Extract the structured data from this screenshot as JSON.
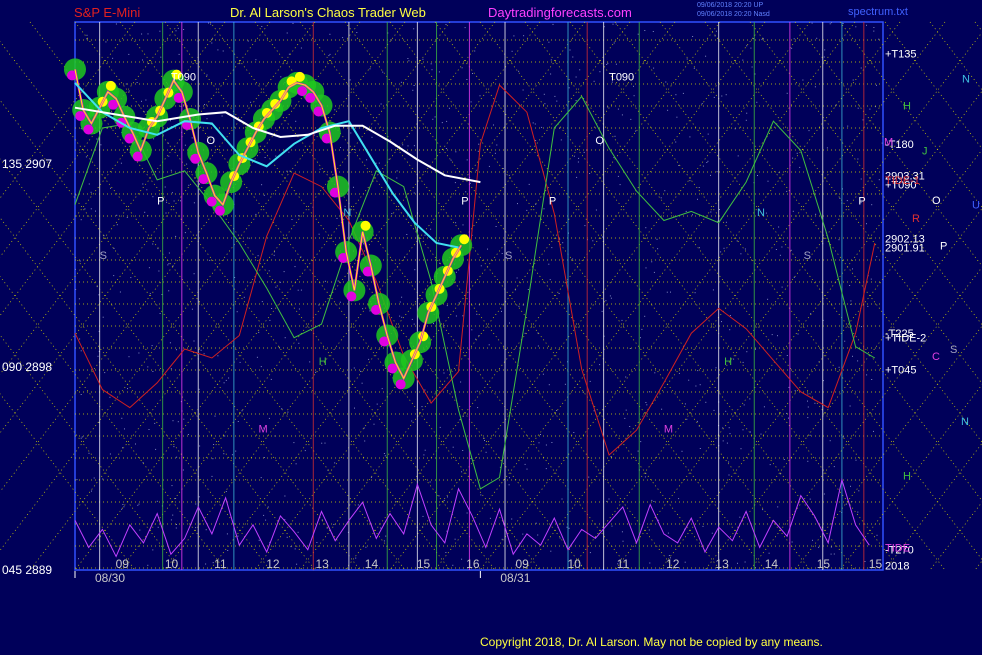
{
  "header": {
    "left": "S&P E-Mini",
    "center": "Dr. Al Larson's Chaos Trader Web",
    "site": "Daytradingforecasts.com",
    "stamp1": "09/06/2018 20:20 UP",
    "stamp2": "09/06/2018 20:20 Nasd",
    "right": "spectrum.txt"
  },
  "footer": {
    "copyright": "Copyright 2018, Dr. Al Larson. May not be copied by any means."
  },
  "colors": {
    "background": "#00005a",
    "grid_yellow": "#d8d800",
    "price_magenta": "#e000e0",
    "highlight_green": "#1ec81e",
    "highlight_yellow": "#ffff00",
    "ma_cyan": "#40e0f0",
    "ma_white": "#ffffff",
    "cycle_red": "#d02020",
    "cycle_green": "#40c040",
    "spectrum_violet": "#c040ff"
  },
  "chart_data": {
    "type": "line",
    "x_day_labels": [
      {
        "text": "08/30",
        "x": 0
      },
      {
        "text": "08/31",
        "x": 14.8
      }
    ],
    "x_hour_ticks": [
      {
        "text": "09",
        "x": 1.7
      },
      {
        "text": "10",
        "x": 3.5
      },
      {
        "text": "11",
        "x": 5.3
      },
      {
        "text": "12",
        "x": 7.2
      },
      {
        "text": "13",
        "x": 9.0
      },
      {
        "text": "14",
        "x": 10.8
      },
      {
        "text": "15",
        "x": 12.7
      },
      {
        "text": "16",
        "x": 14.5
      },
      {
        "text": "09",
        "x": 16.3
      },
      {
        "text": "10",
        "x": 18.2
      },
      {
        "text": "11",
        "x": 20.0
      },
      {
        "text": "12",
        "x": 21.8
      },
      {
        "text": "13",
        "x": 23.6
      },
      {
        "text": "14",
        "x": 25.4
      },
      {
        "text": "15",
        "x": 27.3
      },
      {
        "text": "15",
        "x": 29.2
      }
    ],
    "xlim": [
      0,
      29.5
    ],
    "y_left_ticks": [
      {
        "text": "135  2907",
        "y": 2907
      },
      {
        "text": "090  2898",
        "y": 2898
      },
      {
        "text": "045  2889",
        "y": 2889
      }
    ],
    "ylim": [
      2889,
      2913.3
    ],
    "right_labels": [
      {
        "text": "+T135",
        "y": 2911.9,
        "color": "#ffffff"
      },
      {
        "text": "-T180",
        "y": 2907.9,
        "color": "#ffffff"
      },
      {
        "text": "2903.31",
        "y": 2906.5,
        "color": "#ffffff"
      },
      {
        "text": "+T090",
        "y": 2906.1,
        "color": "#ffffff"
      },
      {
        "text": "2902.13",
        "y": 2903.7,
        "color": "#ffffff"
      },
      {
        "text": "2901.91",
        "y": 2903.3,
        "color": "#ffffff"
      },
      {
        "text": "-T225",
        "y": 2899.5,
        "color": "#ffffff"
      },
      {
        "text": "+TIDE-2",
        "y": 2899.3,
        "color": "#ffffff"
      },
      {
        "text": "+T045",
        "y": 2897.9,
        "color": "#ffffff"
      },
      {
        "text": "-T270",
        "y": 2889.9,
        "color": "#ffffff"
      },
      {
        "text": "TIDE",
        "y": 2890.0,
        "color": "#e040e0"
      },
      {
        "text": "2018",
        "y": 2889.2,
        "color": "#ffffff"
      },
      {
        "text": "TIDE-1",
        "y": 2906.3,
        "color": "#e03030"
      }
    ],
    "side_letters": [
      {
        "text": "N",
        "color": "#40c0e0",
        "y": 2910.8
      },
      {
        "text": "H",
        "color": "#40c040",
        "y": 2909.6
      },
      {
        "text": "M",
        "color": "#e040e0",
        "y": 2908.0
      },
      {
        "text": "J",
        "color": "#40c040",
        "y": 2907.6
      },
      {
        "text": "O",
        "color": "#ffffff",
        "y": 2905.4
      },
      {
        "text": "U",
        "color": "#4060ff",
        "y": 2905.2
      },
      {
        "text": "R",
        "color": "#e03030",
        "y": 2904.6
      },
      {
        "text": "P",
        "color": "#ffffff",
        "y": 2903.4
      },
      {
        "text": "C",
        "color": "#e040e0",
        "y": 2898.5
      },
      {
        "text": "S",
        "color": "#a0a0c0",
        "y": 2898.8
      },
      {
        "text": "N",
        "color": "#40c0e0",
        "y": 2895.6
      },
      {
        "text": "H",
        "color": "#40c040",
        "y": 2893.2
      }
    ],
    "chart_labels": [
      {
        "text": "T090",
        "x": 3.5,
        "y": 2910.7,
        "color": "#ffffff"
      },
      {
        "text": "T090",
        "x": 19.5,
        "y": 2910.7,
        "color": "#ffffff"
      },
      {
        "text": "O",
        "x": 4.8,
        "y": 2907.9,
        "color": "#ffffff"
      },
      {
        "text": "O",
        "x": 19.0,
        "y": 2907.9,
        "color": "#ffffff"
      },
      {
        "text": "P",
        "x": 3.0,
        "y": 2905.2,
        "color": "#ffffff"
      },
      {
        "text": "P",
        "x": 14.1,
        "y": 2905.2,
        "color": "#ffffff"
      },
      {
        "text": "P",
        "x": 17.3,
        "y": 2905.2,
        "color": "#ffffff"
      },
      {
        "text": "P",
        "x": 28.6,
        "y": 2905.2,
        "color": "#ffffff"
      },
      {
        "text": "N",
        "x": 9.8,
        "y": 2904.7,
        "color": "#40c0e0"
      },
      {
        "text": "N",
        "x": 24.9,
        "y": 2904.7,
        "color": "#40c0e0"
      },
      {
        "text": "S",
        "x": 0.9,
        "y": 2902.8,
        "color": "#a0a0c0"
      },
      {
        "text": "S",
        "x": 15.7,
        "y": 2902.8,
        "color": "#a0a0c0"
      },
      {
        "text": "S",
        "x": 26.6,
        "y": 2902.8,
        "color": "#a0a0c0"
      },
      {
        "text": "H",
        "x": 8.9,
        "y": 2898.1,
        "color": "#40c040"
      },
      {
        "text": "H",
        "x": 23.7,
        "y": 2898.1,
        "color": "#40c040"
      },
      {
        "text": "M",
        "x": 6.7,
        "y": 2895.1,
        "color": "#e040e0"
      },
      {
        "text": "M",
        "x": 21.5,
        "y": 2895.1,
        "color": "#e040e0"
      }
    ],
    "series": [
      {
        "style": "price",
        "x": [
          0,
          0.3,
          0.6,
          0.9,
          1.2,
          1.5,
          1.8,
          2.1,
          2.4,
          2.7,
          3.0,
          3.3,
          3.6,
          3.9,
          4.2,
          4.5,
          4.8,
          5.1,
          5.4,
          5.7,
          6.0,
          6.3,
          6.6,
          6.9,
          7.2,
          7.5,
          7.8,
          8.1,
          8.4,
          8.7,
          9.0,
          9.3,
          9.6,
          9.9,
          10.2,
          10.5,
          10.8,
          11.1,
          11.4,
          11.7,
          12.0,
          12.3,
          12.6,
          12.9,
          13.2,
          13.5,
          13.8,
          14.1
        ],
        "y": [
          2911.2,
          2909.4,
          2908.8,
          2909.5,
          2910.2,
          2909.9,
          2909.1,
          2908.4,
          2907.6,
          2908.6,
          2909.1,
          2909.9,
          2910.7,
          2910.2,
          2909.0,
          2907.5,
          2906.6,
          2905.6,
          2905.2,
          2906.2,
          2907.0,
          2907.7,
          2908.4,
          2909.0,
          2909.4,
          2909.8,
          2910.4,
          2910.6,
          2910.5,
          2910.2,
          2909.6,
          2908.4,
          2906.0,
          2903.1,
          2901.4,
          2904.0,
          2902.5,
          2900.8,
          2899.4,
          2898.2,
          2897.5,
          2898.3,
          2899.1,
          2900.4,
          2901.2,
          2902.0,
          2902.8,
          2903.4
        ]
      },
      {
        "style": "ma-cyan",
        "x": [
          0,
          1.0,
          2.0,
          3.0,
          4.0,
          5.0,
          6.0,
          7.0,
          8.0,
          9.0,
          10.0,
          10.8,
          11.6,
          12.4,
          13.2,
          14.0
        ],
        "y": [
          2910.6,
          2909.3,
          2908.6,
          2908.3,
          2908.9,
          2908.8,
          2907.4,
          2906.9,
          2907.9,
          2908.6,
          2908.9,
          2907.3,
          2905.7,
          2904.4,
          2903.5,
          2903.3
        ]
      },
      {
        "style": "ma-white",
        "x": [
          0,
          1.5,
          3.0,
          4.5,
          5.5,
          6.5,
          7.5,
          8.5,
          9.5,
          10.5,
          11.5,
          12.5,
          13.5,
          14.8
        ],
        "y": [
          2909.5,
          2909.2,
          2908.9,
          2909.2,
          2909.3,
          2908.6,
          2908.2,
          2908.3,
          2908.7,
          2908.7,
          2908.0,
          2907.2,
          2906.5,
          2906.2
        ]
      },
      {
        "style": "cycle-red",
        "x": [
          0,
          1.0,
          2.0,
          3.0,
          4.0,
          5.0,
          6.0,
          7.0,
          8.0,
          9.0,
          10.0,
          11.0,
          12.0,
          13.0,
          14.0,
          14.8,
          15.5,
          16.5,
          17.5,
          18.5,
          19.5,
          20.5,
          21.5,
          22.5,
          23.5,
          24.5,
          25.5,
          26.5,
          27.5,
          28.5,
          29.2
        ],
        "y": [
          2899.5,
          2897.0,
          2896.2,
          2897.3,
          2898.8,
          2898.4,
          2899.4,
          2903.8,
          2906.6,
          2906.0,
          2904.5,
          2901.8,
          2898.5,
          2896.4,
          2897.8,
          2907.9,
          2910.5,
          2909.3,
          2904.8,
          2897.9,
          2894.1,
          2895.2,
          2897.3,
          2899.5,
          2900.6,
          2899.7,
          2898.3,
          2896.9,
          2896.2,
          2899.5,
          2903.5
        ]
      },
      {
        "style": "cycle-green",
        "x": [
          0,
          1.0,
          2.0,
          3.0,
          4.0,
          5.0,
          6.0,
          7.0,
          8.0,
          9.0,
          10.0,
          11.0,
          12.0,
          13.0,
          14.0,
          14.8,
          15.5,
          16.5,
          17.5,
          18.5,
          19.5,
          20.5,
          21.5,
          22.5,
          23.5,
          24.5,
          25.5,
          26.5,
          27.5,
          28.5,
          29.2
        ],
        "y": [
          2905.2,
          2908.6,
          2908.8,
          2906.3,
          2906.7,
          2905.2,
          2903.5,
          2901.5,
          2899.3,
          2899.9,
          2903.6,
          2906.7,
          2906.0,
          2901.8,
          2896.1,
          2892.6,
          2893.1,
          2900.6,
          2908.6,
          2910.0,
          2907.7,
          2905.8,
          2904.5,
          2904.9,
          2904.4,
          2906.2,
          2908.9,
          2907.6,
          2903.7,
          2898.9,
          2898.4
        ]
      },
      {
        "style": "spectrum",
        "x": [
          0,
          0.5,
          1.0,
          1.5,
          2.0,
          2.5,
          3.0,
          3.5,
          4.0,
          4.5,
          5.0,
          5.5,
          6.0,
          6.5,
          7.0,
          7.5,
          8.0,
          8.5,
          9.0,
          9.5,
          10.0,
          10.5,
          11.0,
          11.5,
          12.0,
          12.5,
          13.0,
          13.5,
          14.0,
          14.5,
          15.0,
          15.5,
          16.0,
          16.5,
          17.0,
          17.5,
          18.0,
          18.5,
          19.0,
          19.5,
          20.0,
          20.5,
          21.0,
          21.5,
          22.0,
          22.5,
          23.0,
          23.5,
          24.0,
          24.5,
          25.0,
          25.5,
          26.0,
          26.5,
          27.0,
          27.5,
          28.0,
          28.5,
          29.0
        ],
        "y": [
          2891.2,
          2890.0,
          2890.8,
          2889.6,
          2891.0,
          2890.2,
          2891.5,
          2889.7,
          2890.4,
          2891.8,
          2890.6,
          2892.2,
          2890.1,
          2891.0,
          2889.8,
          2891.4,
          2890.7,
          2889.9,
          2891.6,
          2890.3,
          2891.2,
          2892.0,
          2890.4,
          2891.5,
          2890.6,
          2892.8,
          2891.0,
          2890.2,
          2892.6,
          2891.4,
          2890.0,
          2891.7,
          2889.7,
          2890.6,
          2890.1,
          2891.3,
          2889.9,
          2890.8,
          2890.4,
          2891.1,
          2891.8,
          2890.2,
          2891.9,
          2890.6,
          2890.2,
          2891.3,
          2889.8,
          2890.9,
          2890.3,
          2891.6,
          2890.0,
          2891.2,
          2890.5,
          2892.3,
          2891.4,
          2890.2,
          2893.0,
          2891.0,
          2890.1
        ]
      }
    ],
    "grid": true
  }
}
